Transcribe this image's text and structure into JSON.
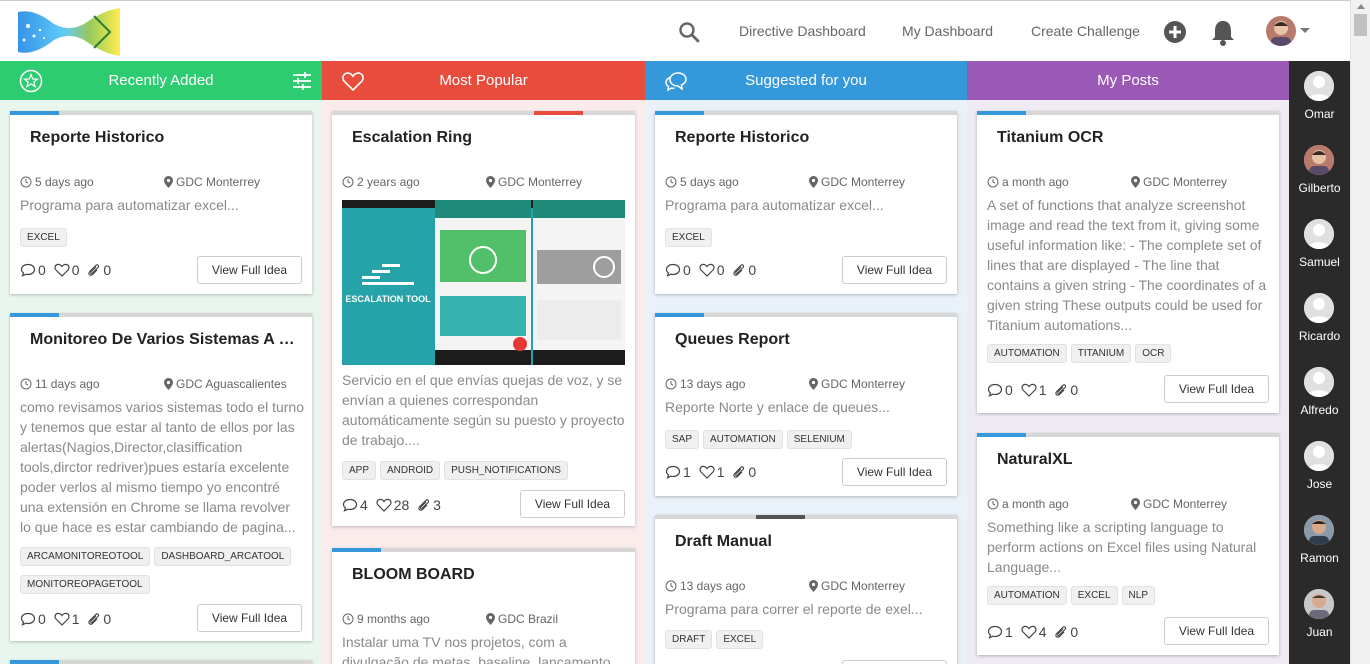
{
  "nav": {
    "directive_dashboard": "Directive Dashboard",
    "my_dashboard": "My Dashboard",
    "create_challenge": "Create Challenge"
  },
  "columns": [
    {
      "title": "Recently Added",
      "color": "#2ecc71",
      "bg": "#e8f6ee",
      "cards": [
        {
          "title": "Reporte Historico",
          "time": "5 days ago",
          "location": "GDC Monterrey",
          "desc": "Programa para automatizar excel...",
          "tags": [
            "EXCEL"
          ],
          "comments": "0",
          "likes": "0",
          "attachments": "0",
          "button": "View Full Idea"
        },
        {
          "title": "Monitoreo De Varios Sistemas A La ...",
          "time": "11 days ago",
          "location": "GDC Aguascalientes",
          "desc": "como revisamos varios sistemas todo el turno y tenemos que estar al tanto de ellos por las alertas(Nagios,Director,clasiffication tools,dirctor redriver)pues estaría excelente poder verlos al mismo tiempo yo encontré una extensión en Chrome se llama revolver lo que hace es estar cambiando de pagina...",
          "tags": [
            "ARCAMONITOREOTOOL",
            "DASHBOARD_ARCATOOL",
            "MONITOREOPAGETOOL"
          ],
          "comments": "0",
          "likes": "1",
          "attachments": "0",
          "button": "View Full Idea"
        }
      ]
    },
    {
      "title": "Most Popular",
      "color": "#e74c3c",
      "bg": "#fbecec",
      "cards": [
        {
          "title": "Escalation Ring",
          "time": "2 years ago",
          "location": "GDC Monterrey",
          "image_text": "ESCALATION TOOL",
          "desc": "Servicio en el que envías quejas de voz, y se envían a quienes correspondan automáticamente según su puesto y proyecto de trabajo....",
          "tags": [
            "APP",
            "ANDROID",
            "PUSH_NOTIFICATIONS"
          ],
          "comments": "4",
          "likes": "28",
          "attachments": "3",
          "button": "View Full Idea"
        },
        {
          "title": "BLOOM BOARD",
          "time": "9 months ago",
          "location": "GDC Brazil",
          "desc": "Instalar uma TV nos projetos, com a divulgação de metas, baseline, lançamento de"
        }
      ]
    },
    {
      "title": "Suggested for you",
      "color": "#3498db",
      "bg": "#e9f1f9",
      "cards": [
        {
          "title": "Reporte Historico",
          "time": "5 days ago",
          "location": "GDC Monterrey",
          "desc": "Programa para automatizar excel...",
          "tags": [
            "EXCEL"
          ],
          "comments": "0",
          "likes": "0",
          "attachments": "0",
          "button": "View Full Idea"
        },
        {
          "title": "Queues Report",
          "time": "13 days ago",
          "location": "GDC Monterrey",
          "desc": "Reporte Norte y enlace de queues...",
          "tags": [
            "SAP",
            "AUTOMATION",
            "SELENIUM"
          ],
          "comments": "1",
          "likes": "1",
          "attachments": "0",
          "button": "View Full Idea"
        },
        {
          "title": "Draft Manual",
          "time": "13 days ago",
          "location": "GDC Monterrey",
          "desc": "Programa para correr el reporte de exel...",
          "tags": [
            "DRAFT",
            "EXCEL"
          ]
        }
      ]
    },
    {
      "title": "My Posts",
      "color": "#9b59b6",
      "bg": "#f0eaf3",
      "cards": [
        {
          "title": "Titanium OCR",
          "time": "a month ago",
          "location": "GDC Monterrey",
          "desc": "A set of functions that analyze screenshot image and read the text from it, giving some useful information like: - The complete set of lines that are displayed - The line that contains a given string - The coordinates of a given string These outputs could be used for Titanium automations...",
          "tags": [
            "AUTOMATION",
            "TITANIUM",
            "OCR"
          ],
          "comments": "0",
          "likes": "1",
          "attachments": "0",
          "button": "View Full Idea"
        },
        {
          "title": "NaturalXL",
          "time": "a month ago",
          "location": "GDC Monterrey",
          "desc": "Something like a scripting language to perform actions on Excel files using Natural Language...",
          "tags": [
            "AUTOMATION",
            "EXCEL",
            "NLP"
          ],
          "comments": "1",
          "likes": "4",
          "attachments": "0",
          "button": "View Full Idea"
        }
      ]
    }
  ],
  "people": [
    "Omar",
    "Gilberto",
    "Samuel",
    "Ricardo",
    "Alfredo",
    "Jose",
    "Ramon",
    "Juan"
  ]
}
